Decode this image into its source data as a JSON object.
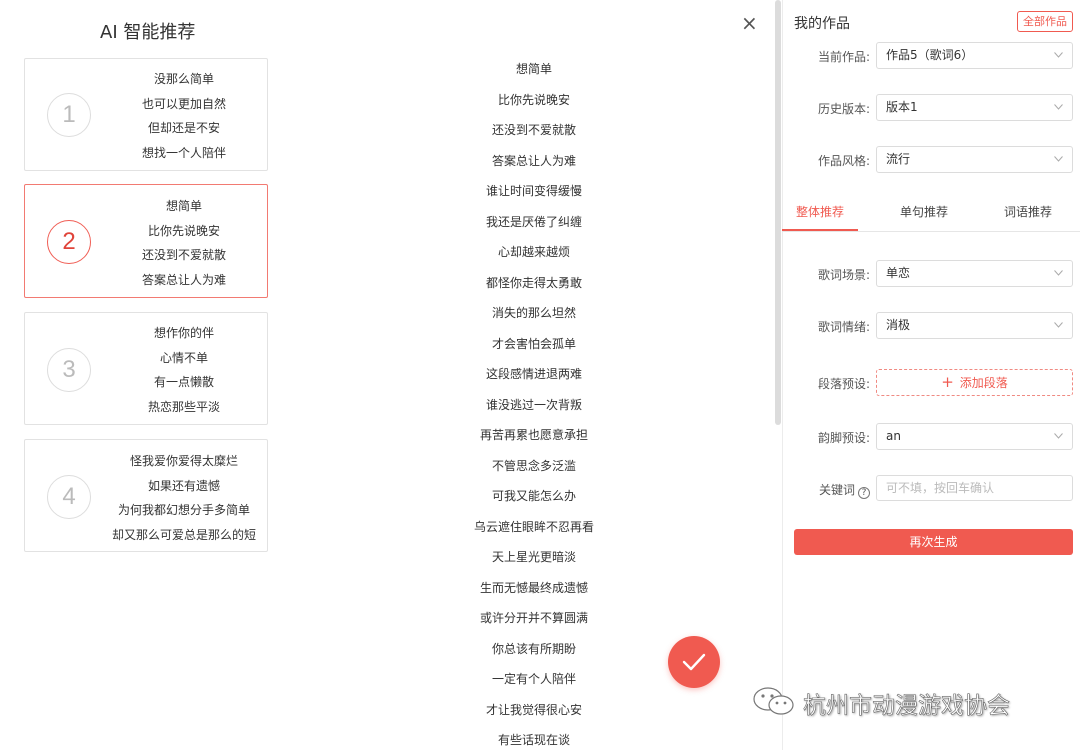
{
  "left": {
    "title": "AI 智能推荐",
    "cards": [
      {
        "num": "1",
        "lines": [
          "没那么简单",
          "也可以更加自然",
          "但却还是不安",
          "想找一个人陪伴"
        ]
      },
      {
        "num": "2",
        "lines": [
          "想简单",
          "比你先说晚安",
          "还没到不爱就散",
          "答案总让人为难"
        ]
      },
      {
        "num": "3",
        "lines": [
          "想作你的伴",
          "心情不单",
          "有一点懒散",
          "热恋那些平淡"
        ]
      },
      {
        "num": "4",
        "lines": [
          "怪我爱你爱得太糜烂",
          "如果还有遗憾",
          "为何我都幻想分手多简单",
          "却又那么可爱总是那么的短"
        ]
      }
    ]
  },
  "middle": {
    "close": "×",
    "lyrics": [
      "想简单",
      "比你先说晚安",
      "还没到不爱就散",
      "答案总让人为难",
      "谁让时间变得缓慢",
      "我还是厌倦了纠缠",
      "心却越来越烦",
      "都怪你走得太勇敢",
      "消失的那么坦然",
      "才会害怕会孤单",
      "这段感情进退两难",
      "谁没逃过一次背叛",
      "再苦再累也愿意承担",
      "不管思念多泛滥",
      "可我又能怎么办",
      "乌云遮住眼眸不忍再看",
      "天上星光更暗淡",
      "生而无憾最终成遗憾",
      "或许分开并不算圆满",
      "你总该有所期盼",
      "一定有个人陪伴",
      "才让我觉得很心安",
      "有些话现在谈"
    ]
  },
  "right": {
    "title": "我的作品",
    "all_works": "全部作品",
    "current_label": "当前作品:",
    "current_value": "作品5（歌词6）",
    "history_label": "历史版本:",
    "history_value": "版本1",
    "style_label": "作品风格:",
    "style_value": "流行",
    "tabs": [
      "整体推荐",
      "单句推荐",
      "词语推荐"
    ],
    "scene_label": "歌词场景:",
    "scene_value": "单恋",
    "mood_label": "歌词情绪:",
    "mood_value": "消极",
    "para_label": "段落预设:",
    "add_para": "添加段落",
    "rhyme_label": "韵脚预设:",
    "rhyme_value": "an",
    "keyword_label": "关键词",
    "keyword_placeholder": "可不填，按回车确认",
    "regenerate": "再次生成"
  },
  "watermark": {
    "text": "杭州市动漫游戏协会"
  },
  "colors": {
    "accent": "#f05a50",
    "border": "#dcdcdc"
  },
  "icons": {
    "close": "close-icon",
    "check": "check-icon",
    "chevron": "chevron-down-icon",
    "help": "help-icon",
    "plus": "plus-icon",
    "wechat": "wechat-icon"
  }
}
